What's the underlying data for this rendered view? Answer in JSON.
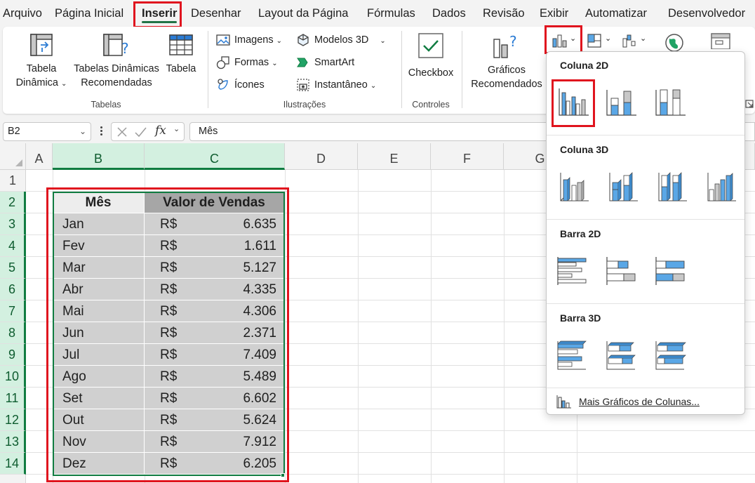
{
  "menu": {
    "tabs": [
      "Arquivo",
      "Página Inicial",
      "Inserir",
      "Desenhar",
      "Layout da Página",
      "Fórmulas",
      "Dados",
      "Revisão",
      "Exibir",
      "Automatizar",
      "Desenvolvedor"
    ],
    "active": "Inserir"
  },
  "ribbon": {
    "tabelas": {
      "pivot_label_1": "Tabela",
      "pivot_label_2": "Dinâmica",
      "rec_pivot_label_1": "Tabelas Dinâmicas",
      "rec_pivot_label_2": "Recomendadas",
      "table_label": "Tabela",
      "group_label": "Tabelas"
    },
    "ilustracoes": {
      "imagens": "Imagens",
      "formas": "Formas",
      "icones": "Ícones",
      "modelos3d": "Modelos 3D",
      "smartart": "SmartArt",
      "instantaneo": "Instantâneo",
      "group_label": "Ilustrações"
    },
    "controles": {
      "checkbox": "Checkbox",
      "group_label": "Controles"
    },
    "graficos": {
      "recomendados_1": "Gráficos",
      "recomendados_2": "Recomendados"
    }
  },
  "formula_bar": {
    "name_box": "B2",
    "fx": "fx",
    "content": "Mês"
  },
  "grid": {
    "columns": [
      "A",
      "B",
      "C",
      "D",
      "E",
      "F",
      "G"
    ],
    "rows": [
      "1",
      "2",
      "3",
      "4",
      "5",
      "6",
      "7",
      "8",
      "9",
      "10",
      "11",
      "12",
      "13",
      "14"
    ],
    "selected_columns": [
      "B",
      "C"
    ]
  },
  "table": {
    "headers": [
      "Mês",
      "Valor de Vendas"
    ],
    "currency": "R$",
    "rows": [
      {
        "month": "Jan",
        "value": "6.635"
      },
      {
        "month": "Fev",
        "value": "1.611"
      },
      {
        "month": "Mar",
        "value": "5.127"
      },
      {
        "month": "Abr",
        "value": "4.335"
      },
      {
        "month": "Mai",
        "value": "4.306"
      },
      {
        "month": "Jun",
        "value": "2.371"
      },
      {
        "month": "Jul",
        "value": "7.409"
      },
      {
        "month": "Ago",
        "value": "5.489"
      },
      {
        "month": "Set",
        "value": "6.602"
      },
      {
        "month": "Out",
        "value": "5.624"
      },
      {
        "month": "Nov",
        "value": "7.912"
      },
      {
        "month": "Dez",
        "value": "6.205"
      }
    ]
  },
  "dropdown": {
    "sections": [
      "Coluna 2D",
      "Coluna 3D",
      "Barra 2D",
      "Barra 3D"
    ],
    "more": "Mais Gráficos de Colunas..."
  },
  "colors": {
    "excel_green": "#107c41",
    "highlight_red": "#e0141e",
    "chart_blue": "#5aa7e6",
    "table_header": "#a6a6a6",
    "table_cell": "#d0d0d0"
  }
}
